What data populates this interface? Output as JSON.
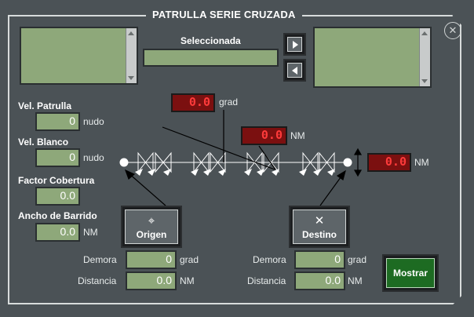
{
  "window": {
    "title": "PATRULLA SERIE CRUZADA"
  },
  "selection": {
    "label": "Seleccionada",
    "value": ""
  },
  "transfer": {
    "add_icon": "arrow-right-icon",
    "remove_icon": "arrow-left-icon"
  },
  "params": {
    "vel_patrulla": {
      "label": "Vel. Patrulla",
      "value": "0",
      "unit": "nudo"
    },
    "vel_blanco": {
      "label": "Vel. Blanco",
      "value": "0",
      "unit": "nudo"
    },
    "factor_cobertura": {
      "label": "Factor Cobertura",
      "value": "0.0"
    },
    "ancho_barrido": {
      "label": "Ancho de Barrido",
      "value": "0.0",
      "unit": "NM"
    }
  },
  "diagram": {
    "angle_display": {
      "value": "0.0",
      "unit": "grad"
    },
    "distance_display": {
      "value": "0.0",
      "unit": "NM"
    },
    "width_display": {
      "value": "0.0",
      "unit": "NM"
    }
  },
  "origen": {
    "button_label": "Origen",
    "icon": "crosshair-icon",
    "demora": {
      "label": "Demora",
      "value": "0",
      "unit": "grad"
    },
    "distancia": {
      "label": "Distancia",
      "value": "0.0",
      "unit": "NM"
    }
  },
  "destino": {
    "button_label": "Destino",
    "icon": "x-mark-icon",
    "demora": {
      "label": "Demora",
      "value": "0",
      "unit": "grad"
    },
    "distancia": {
      "label": "Distancia",
      "value": "0.0",
      "unit": "NM"
    }
  },
  "actions": {
    "mostrar_label": "Mostrar"
  },
  "colors": {
    "panel": "#4b5256",
    "field": "#8ea87a",
    "led_bg": "#7b1010",
    "led_text": "#ff3b3b",
    "accent_green": "#1d6b22"
  }
}
